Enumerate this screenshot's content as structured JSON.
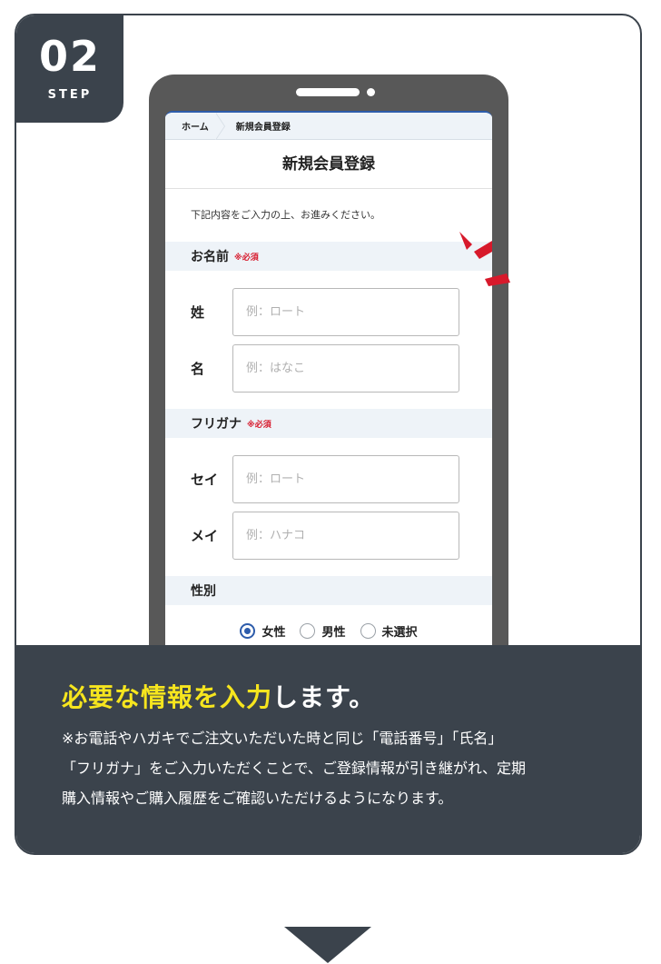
{
  "step": {
    "number": "02",
    "label": "STEP"
  },
  "form": {
    "breadcrumb": [
      "ホーム",
      "新規会員登録"
    ],
    "title": "新規会員登録",
    "intro": "下記内容をご入力の上、お進みください。",
    "required_mark": "※必須",
    "sections": {
      "name": {
        "heading": "お名前",
        "fields": [
          {
            "label": "姓",
            "placeholder": "例：ロート"
          },
          {
            "label": "名",
            "placeholder": "例：はなこ"
          }
        ]
      },
      "kana": {
        "heading": "フリガナ",
        "fields": [
          {
            "label": "セイ",
            "placeholder": "例：ロート"
          },
          {
            "label": "メイ",
            "placeholder": "例：ハナコ"
          }
        ]
      },
      "gender": {
        "heading": "性別",
        "options": [
          "女性",
          "男性",
          "未選択"
        ],
        "selected": "女性"
      }
    }
  },
  "caption": {
    "headline_highlight": "必要な情報を入力",
    "headline_rest": "します。",
    "description_lines": [
      "※お電話やハガキでご注文いただいた時と同じ「電話番号」「氏名」",
      "「フリガナ」をご入力いただくことで、ご登録情報が引き継がれ、定期",
      "購入情報やご購入履歴をご確認いただけるようになります。"
    ]
  },
  "colors": {
    "dark": "#3b434c",
    "highlight": "#f6e51e",
    "accent_red": "#d7192b",
    "form_blue": "#2d5cab"
  }
}
